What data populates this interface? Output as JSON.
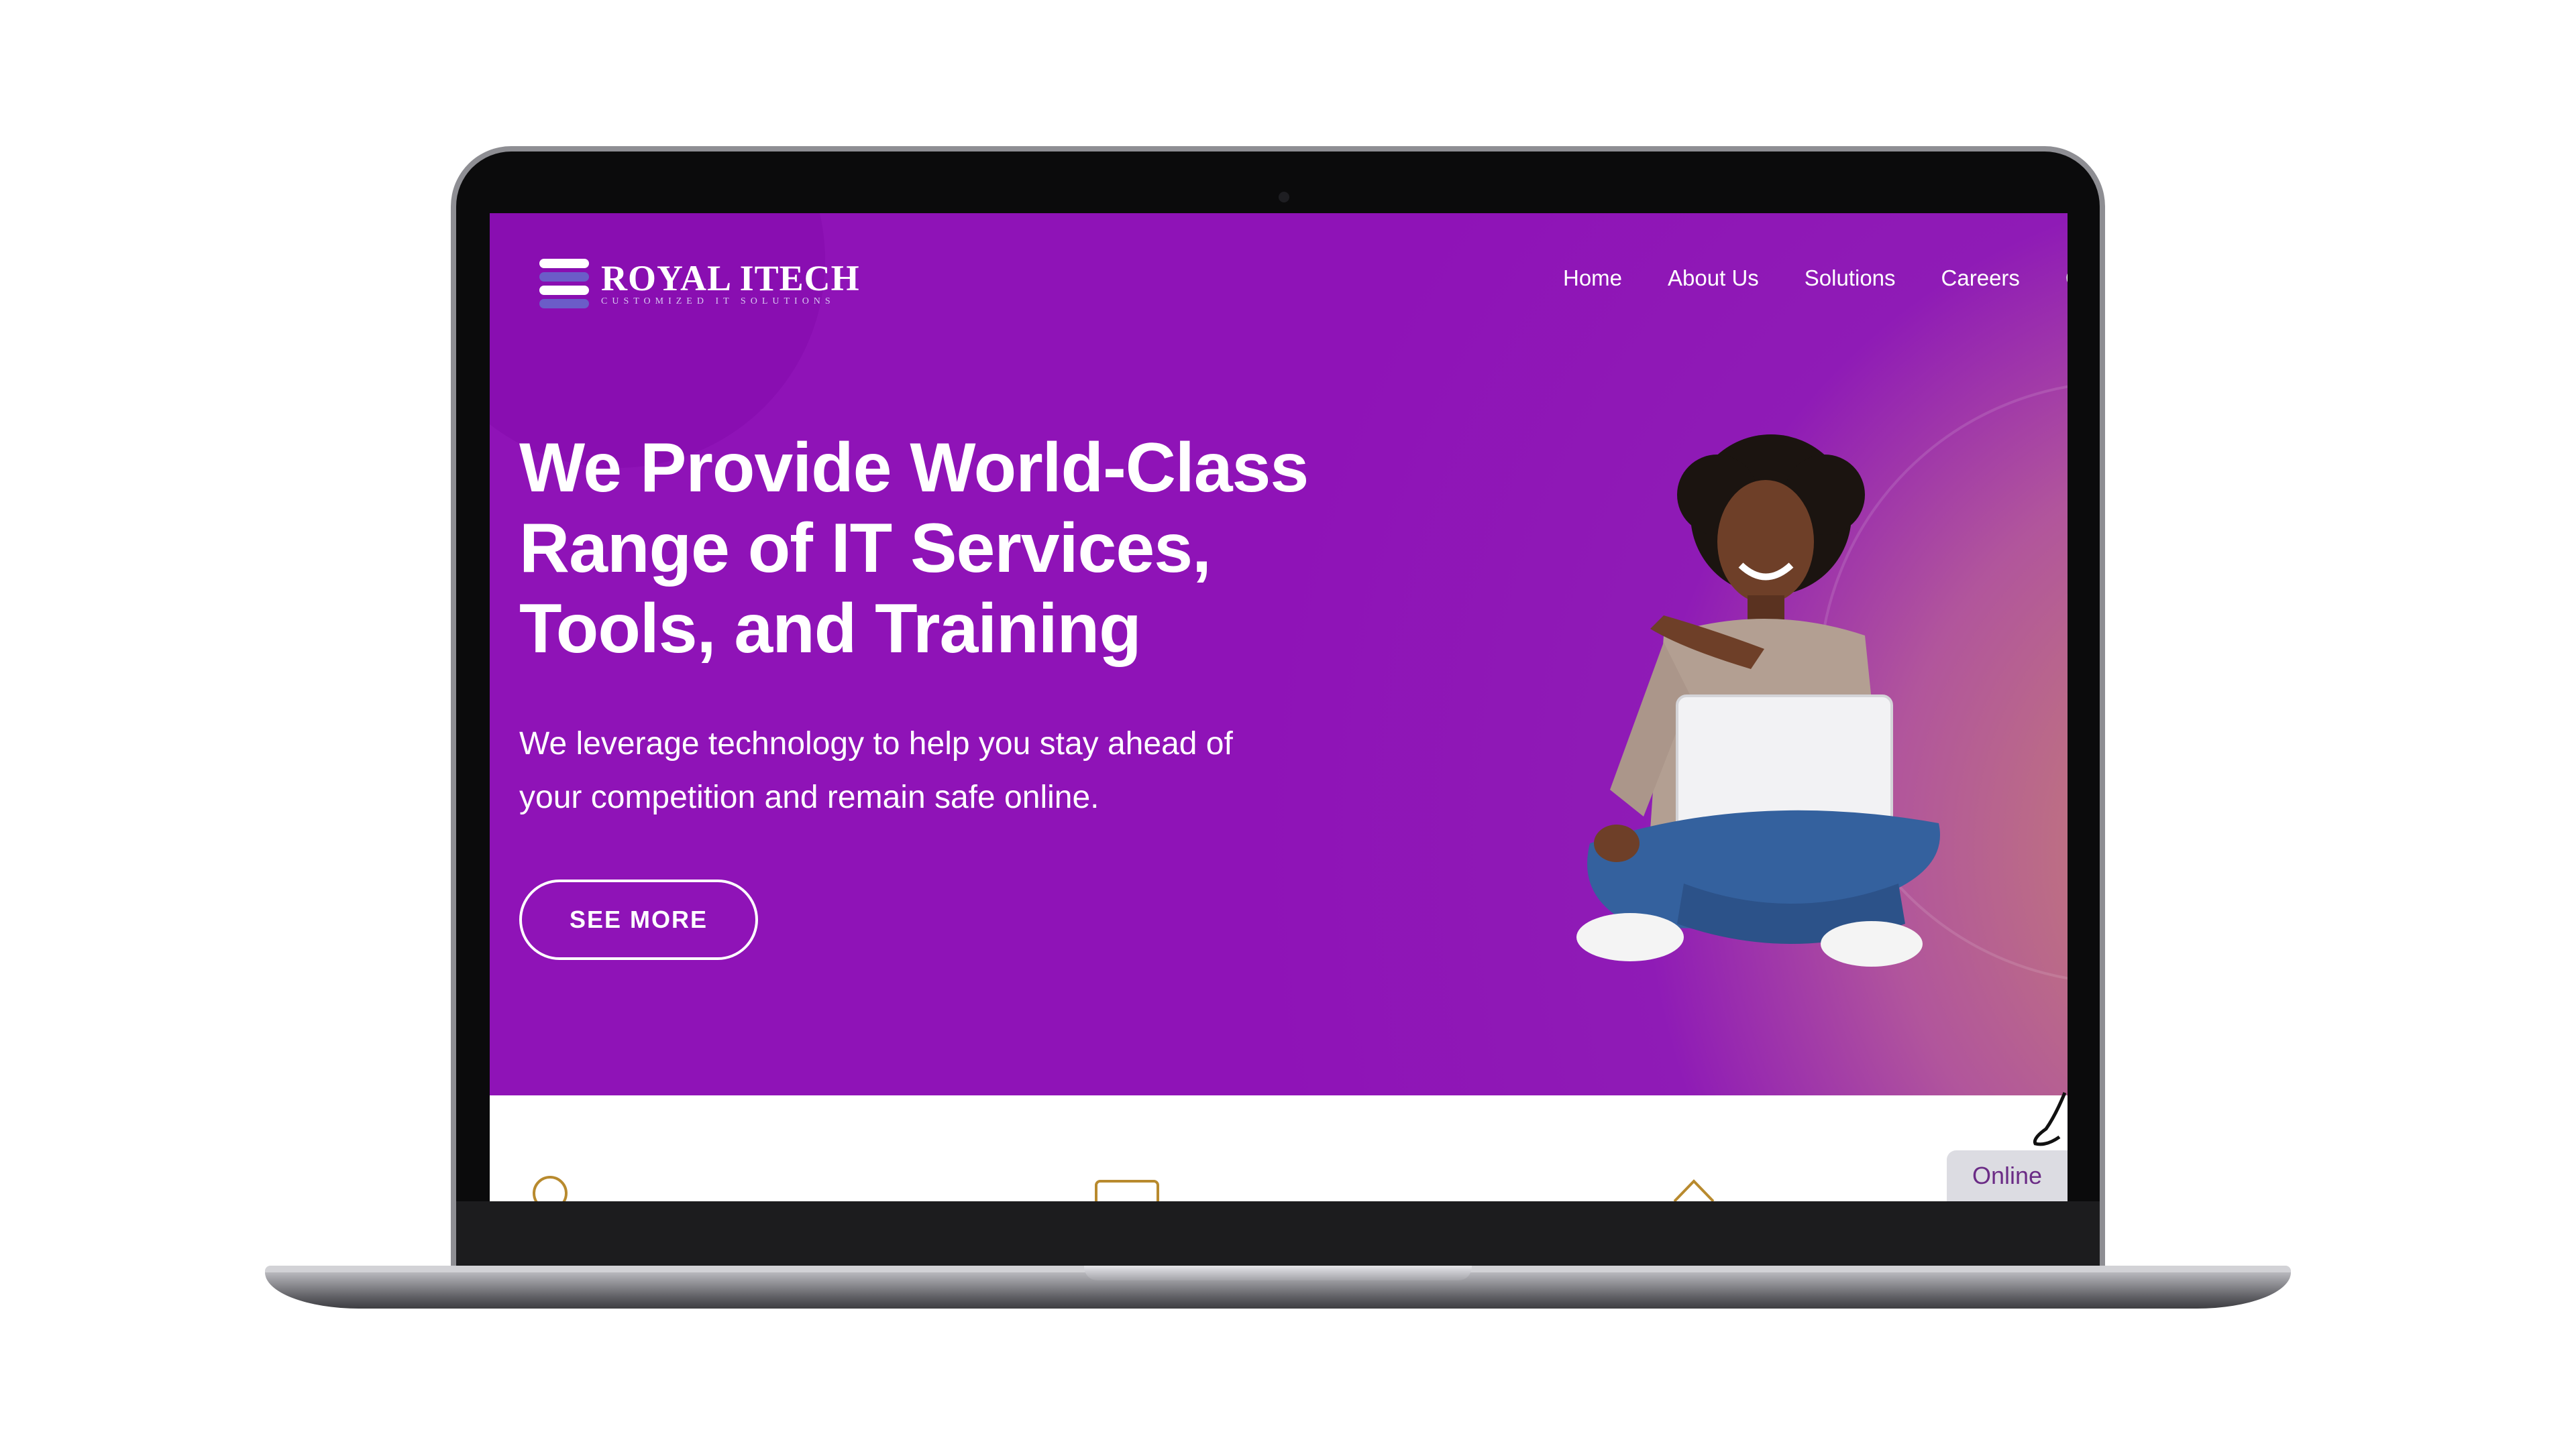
{
  "brand": {
    "name": "ROYAL ITECH",
    "tagline": "CUSTOMIZED IT SOLUTIONS"
  },
  "nav": {
    "items": [
      "Home",
      "About Us",
      "Solutions",
      "Careers",
      "C"
    ]
  },
  "hero": {
    "headline_line1": "We Provide World-Class",
    "headline_line2": "Range of IT Services,",
    "headline_line3": "Tools, and Training",
    "subtext_line1": "We leverage technology to help you stay ahead of",
    "subtext_line2": "your competition and remain safe online.",
    "cta_label": "SEE MORE"
  },
  "chat": {
    "status_label": "Online"
  },
  "icons": [
    "search-icon",
    "monitor-icon",
    "chevron-up-icon",
    "chat-bubble-icon"
  ],
  "colors": {
    "hero_purple": "#8f13b7",
    "hero_warm": "#c98a6a",
    "text_white": "#ffffff",
    "online_text": "#6b2c86"
  }
}
